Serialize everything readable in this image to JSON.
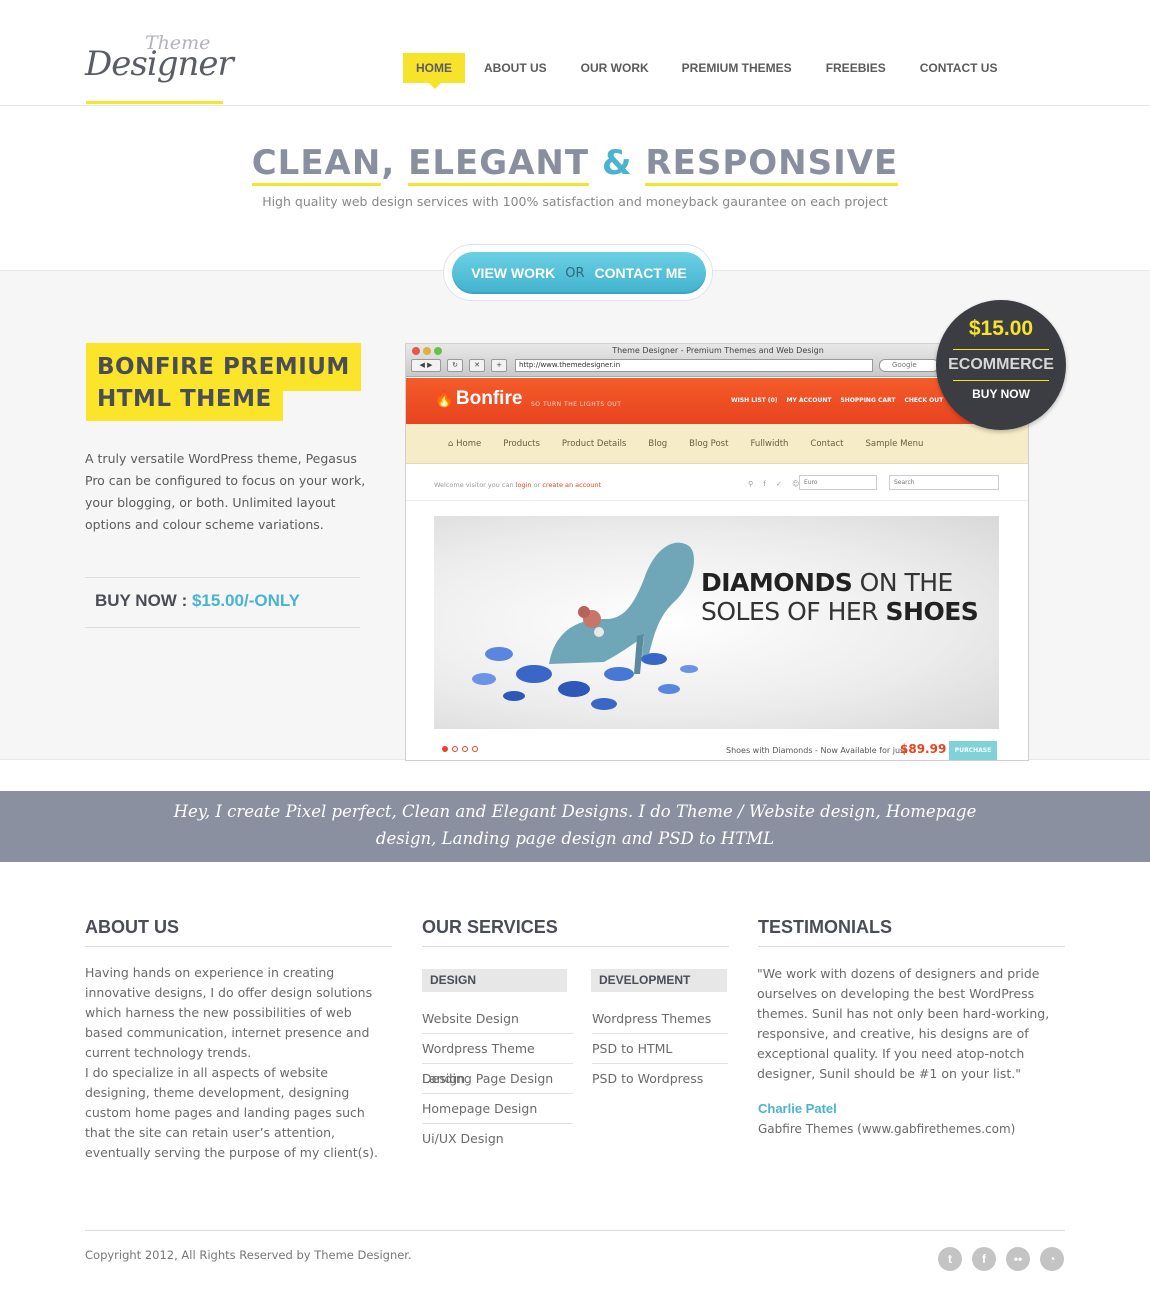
{
  "logo": {
    "small": "Theme",
    "big": "Designer"
  },
  "nav": [
    {
      "label": "HOME",
      "active": true
    },
    {
      "label": "ABOUT US"
    },
    {
      "label": "OUR WORK"
    },
    {
      "label": "PREMIUM THEMES"
    },
    {
      "label": "FREEBIES"
    },
    {
      "label": "CONTACT US"
    }
  ],
  "hero": {
    "title_part1": "CLEAN",
    "title_sep": ", ",
    "title_part2": "ELEGANT",
    "title_amp": "&",
    "title_part3": "RESPONSIVE",
    "subtitle": "High quality web design services with 100% satisfaction and moneyback gaurantee on each project",
    "cta_view": "VIEW WORK",
    "cta_or": "OR",
    "cta_contact": "CONTACT ME"
  },
  "featured": {
    "title_line1": "BONFIRE PREMIUM",
    "title_line2": "HTML THEME",
    "description": "A truly versatile WordPress theme, Pegasus Pro can be configured to focus on your work, your blogging, or both. Unlimited layout options and colour scheme variations.",
    "buy_label": "BUY NOW : ",
    "buy_price": "$15.00/-ONLY"
  },
  "badge": {
    "price": "$15.00",
    "category": "ECOMMERCE",
    "buy": "BUY NOW"
  },
  "browser": {
    "window_title": "Theme Designer - Premium Themes and Web Design",
    "url": "http://www.themedesigner.in",
    "search_placeholder": "Google",
    "site_name": "Bonfire",
    "site_tagline": "SO TURN THE LIGHTS OUT",
    "site_links": [
      "WISH LIST (0)",
      "MY ACCOUNT",
      "SHOPPING CART",
      "CHECK OUT"
    ],
    "site_nav": [
      "Home",
      "Products",
      "Product Details",
      "Blog",
      "Blog Post",
      "Fullwidth",
      "Contact",
      "Sample Menu"
    ],
    "welcome_prefix": "Welcome visitor you can ",
    "welcome_login": "login",
    "welcome_or": " or ",
    "welcome_create": "create an account",
    "currency": "Euro",
    "site_search": "Search",
    "slide_word1": "DIAMONDS",
    "slide_word2": " ON THE",
    "slide_word3": "SOLES OF HER ",
    "slide_word4": "SHOES",
    "availability": "Shoes with Diamonds - Now Available for just",
    "availability_price": "$89.99",
    "purchase": "PURCHASE",
    "slide_index": 1,
    "slide_count": 4
  },
  "quote": "Hey, I create Pixel perfect, Clean and Elegant Designs. I do Theme / Website design, Homepage design, Landing page design and PSD to HTML",
  "about": {
    "heading": "ABOUT US",
    "p1": "Having hands on experience in creating innovative designs, I do offer design solutions which harness the new possibilities of web based communication, internet presence and current technology trends.",
    "p2": "I do specialize in all aspects of website designing, theme development, designing custom home pages and landing pages such that the site can retain user’s attention, eventually serving the purpose of my client(s)."
  },
  "services": {
    "heading": "OUR SERVICES",
    "design_label": "DESIGN",
    "design": [
      "Website Design",
      "Wordpress Theme Design",
      "Landing Page Design",
      "Homepage Design",
      "Ui/UX Design"
    ],
    "development_label": "DEVELOPMENT",
    "development": [
      "Wordpress Themes",
      "PSD to HTML",
      "PSD to Wordpress"
    ]
  },
  "testimonials": {
    "heading": "TESTIMONIALS",
    "quote": "\"We work with dozens of designers and pride ourselves on developing the best WordPress themes. Sunil has not only been hard-working, responsive, and creative, his designs are of exceptional quality. If you need atop-notch designer, Sunil should be #1 on your list.\"",
    "name": "Charlie Patel",
    "company": "Gabfire Themes (www.gabfirethemes.com)"
  },
  "footer": {
    "copyright": "Copyright 2012, All Rights Reserved by Theme Designer.",
    "social": [
      "twitter-icon",
      "facebook-icon",
      "flickr-icon",
      "rss-icon"
    ]
  },
  "colors": {
    "accent_yellow": "#f8e32b",
    "accent_blue": "#4ab3d0",
    "banner_grey": "#8b90a1",
    "dark": "#3b3d42"
  }
}
